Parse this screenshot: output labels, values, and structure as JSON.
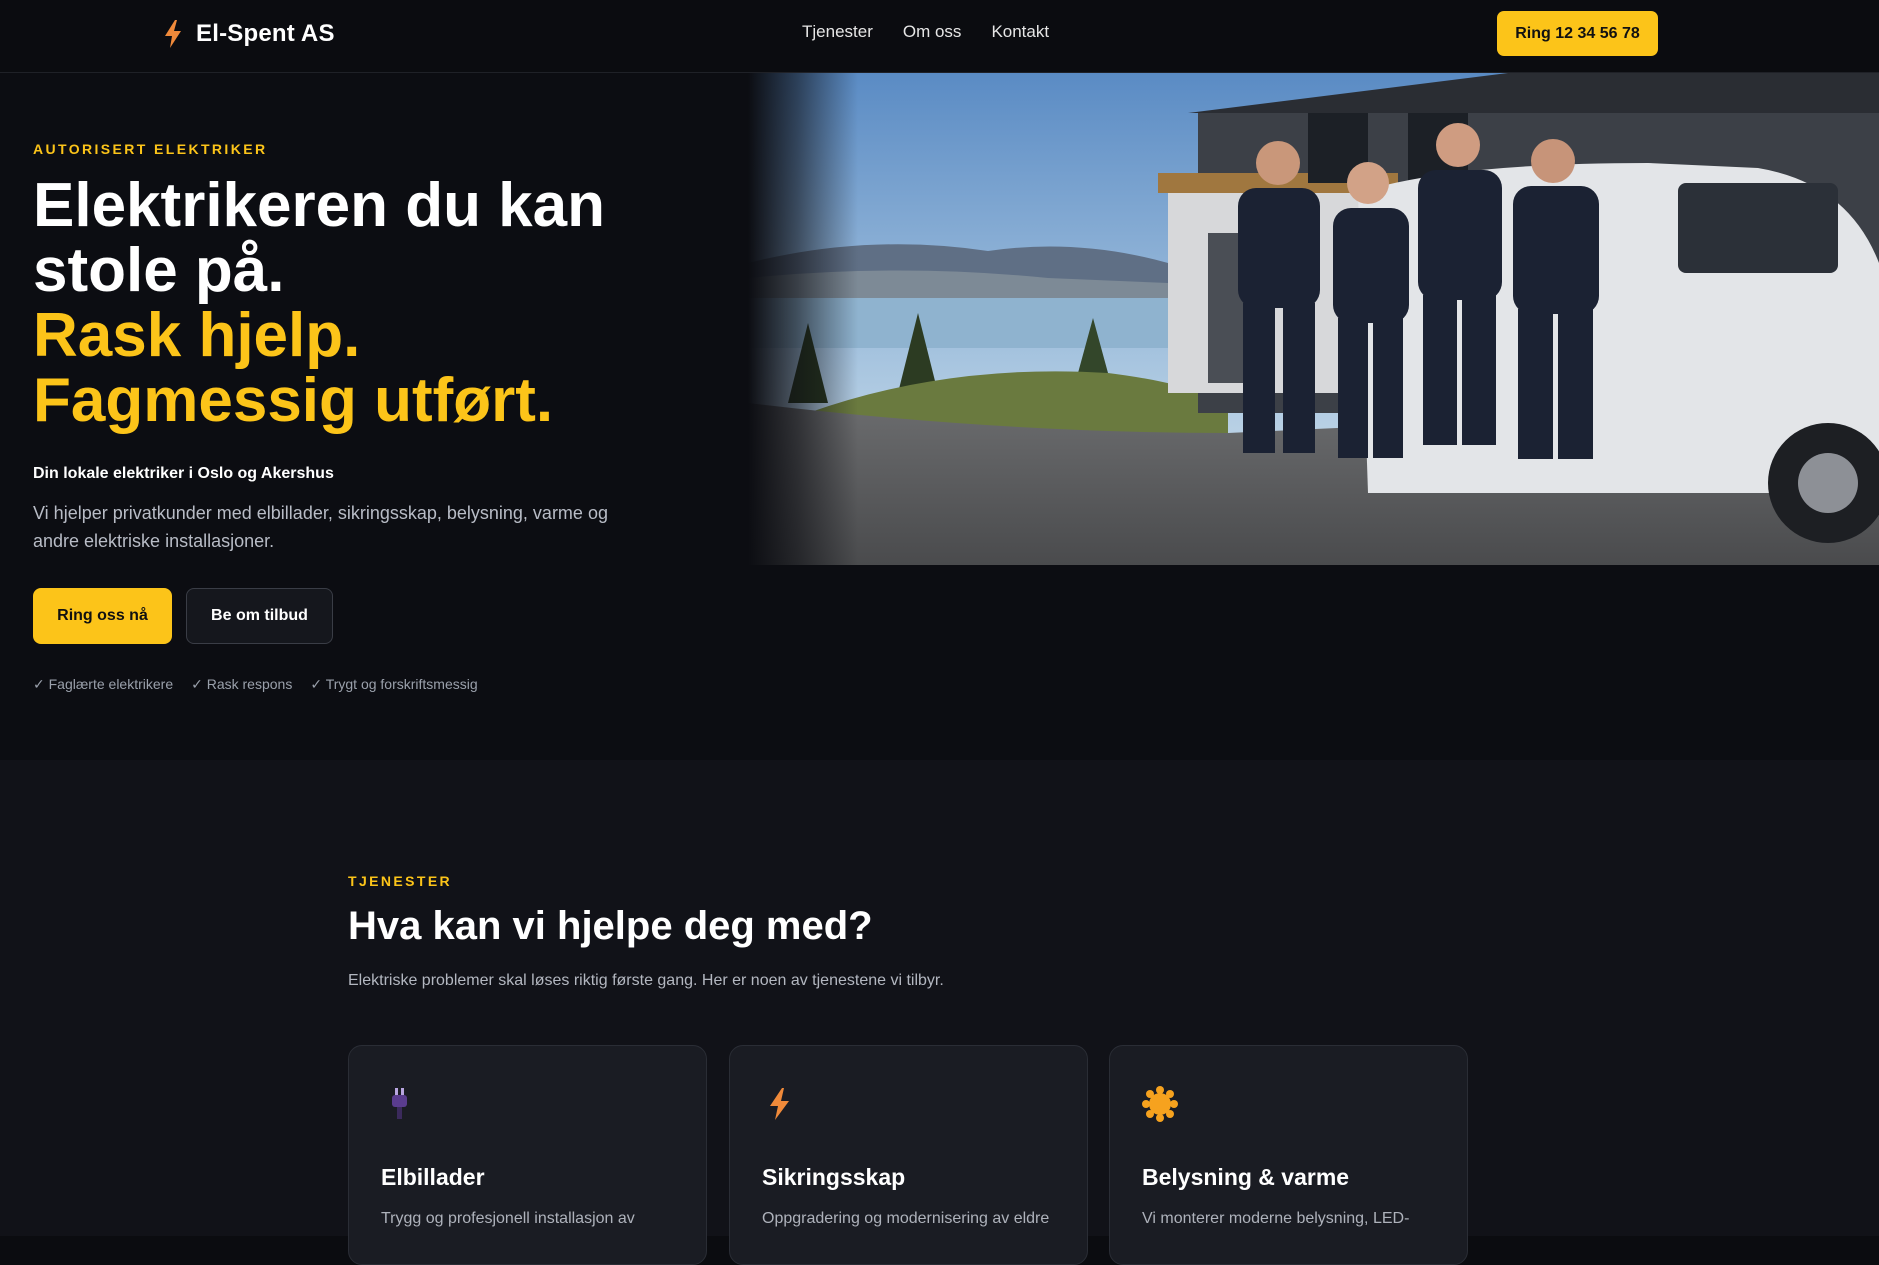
{
  "nav": {
    "brand_icon": "lightning-icon",
    "brand_name": "El-Spent AS",
    "links": [
      "Tjenester",
      "Om oss",
      "Kontakt"
    ],
    "cta": "Ring 12 34 56 78"
  },
  "hero": {
    "eyebrow": "AUTORISERT ELEKTRIKER",
    "title_line1": "Elektrikeren du kan",
    "title_line2": "stole på.",
    "title_accent1": "Rask hjelp.",
    "title_accent2": "Fagmessig utført.",
    "subtitle": "Din lokale elektriker i Oslo og Akershus",
    "body": "Vi hjelper privatkunder med elbillader, sikringsskap, belysning, varme og andre elektriske installasjoner.",
    "primary_button": "Ring oss nå",
    "secondary_button": "Be om tilbud",
    "checks": [
      "✓ Faglærte elektrikere",
      "✓ Rask respons",
      "✓ Trygt og forskriftsmessig"
    ]
  },
  "services": {
    "eyebrow": "TJENESTER",
    "title": "Hva kan vi hjelpe deg med?",
    "subtitle": "Elektriske problemer skal løses riktig første gang. Her er noen av tjenestene vi tilbyr.",
    "cards": [
      {
        "icon": "plug-icon",
        "title": "Elbillader",
        "text": "Trygg og profesjonell installasjon av"
      },
      {
        "icon": "lightning-icon",
        "title": "Sikringsskap",
        "text": "Oppgradering og modernisering av eldre"
      },
      {
        "icon": "sun-icon",
        "title": "Belysning & varme",
        "text": "Vi monterer moderne belysning, LED-"
      }
    ]
  },
  "colors": {
    "accent": "#fcc419",
    "background": "#0b0c10",
    "card": "#1a1c23"
  }
}
